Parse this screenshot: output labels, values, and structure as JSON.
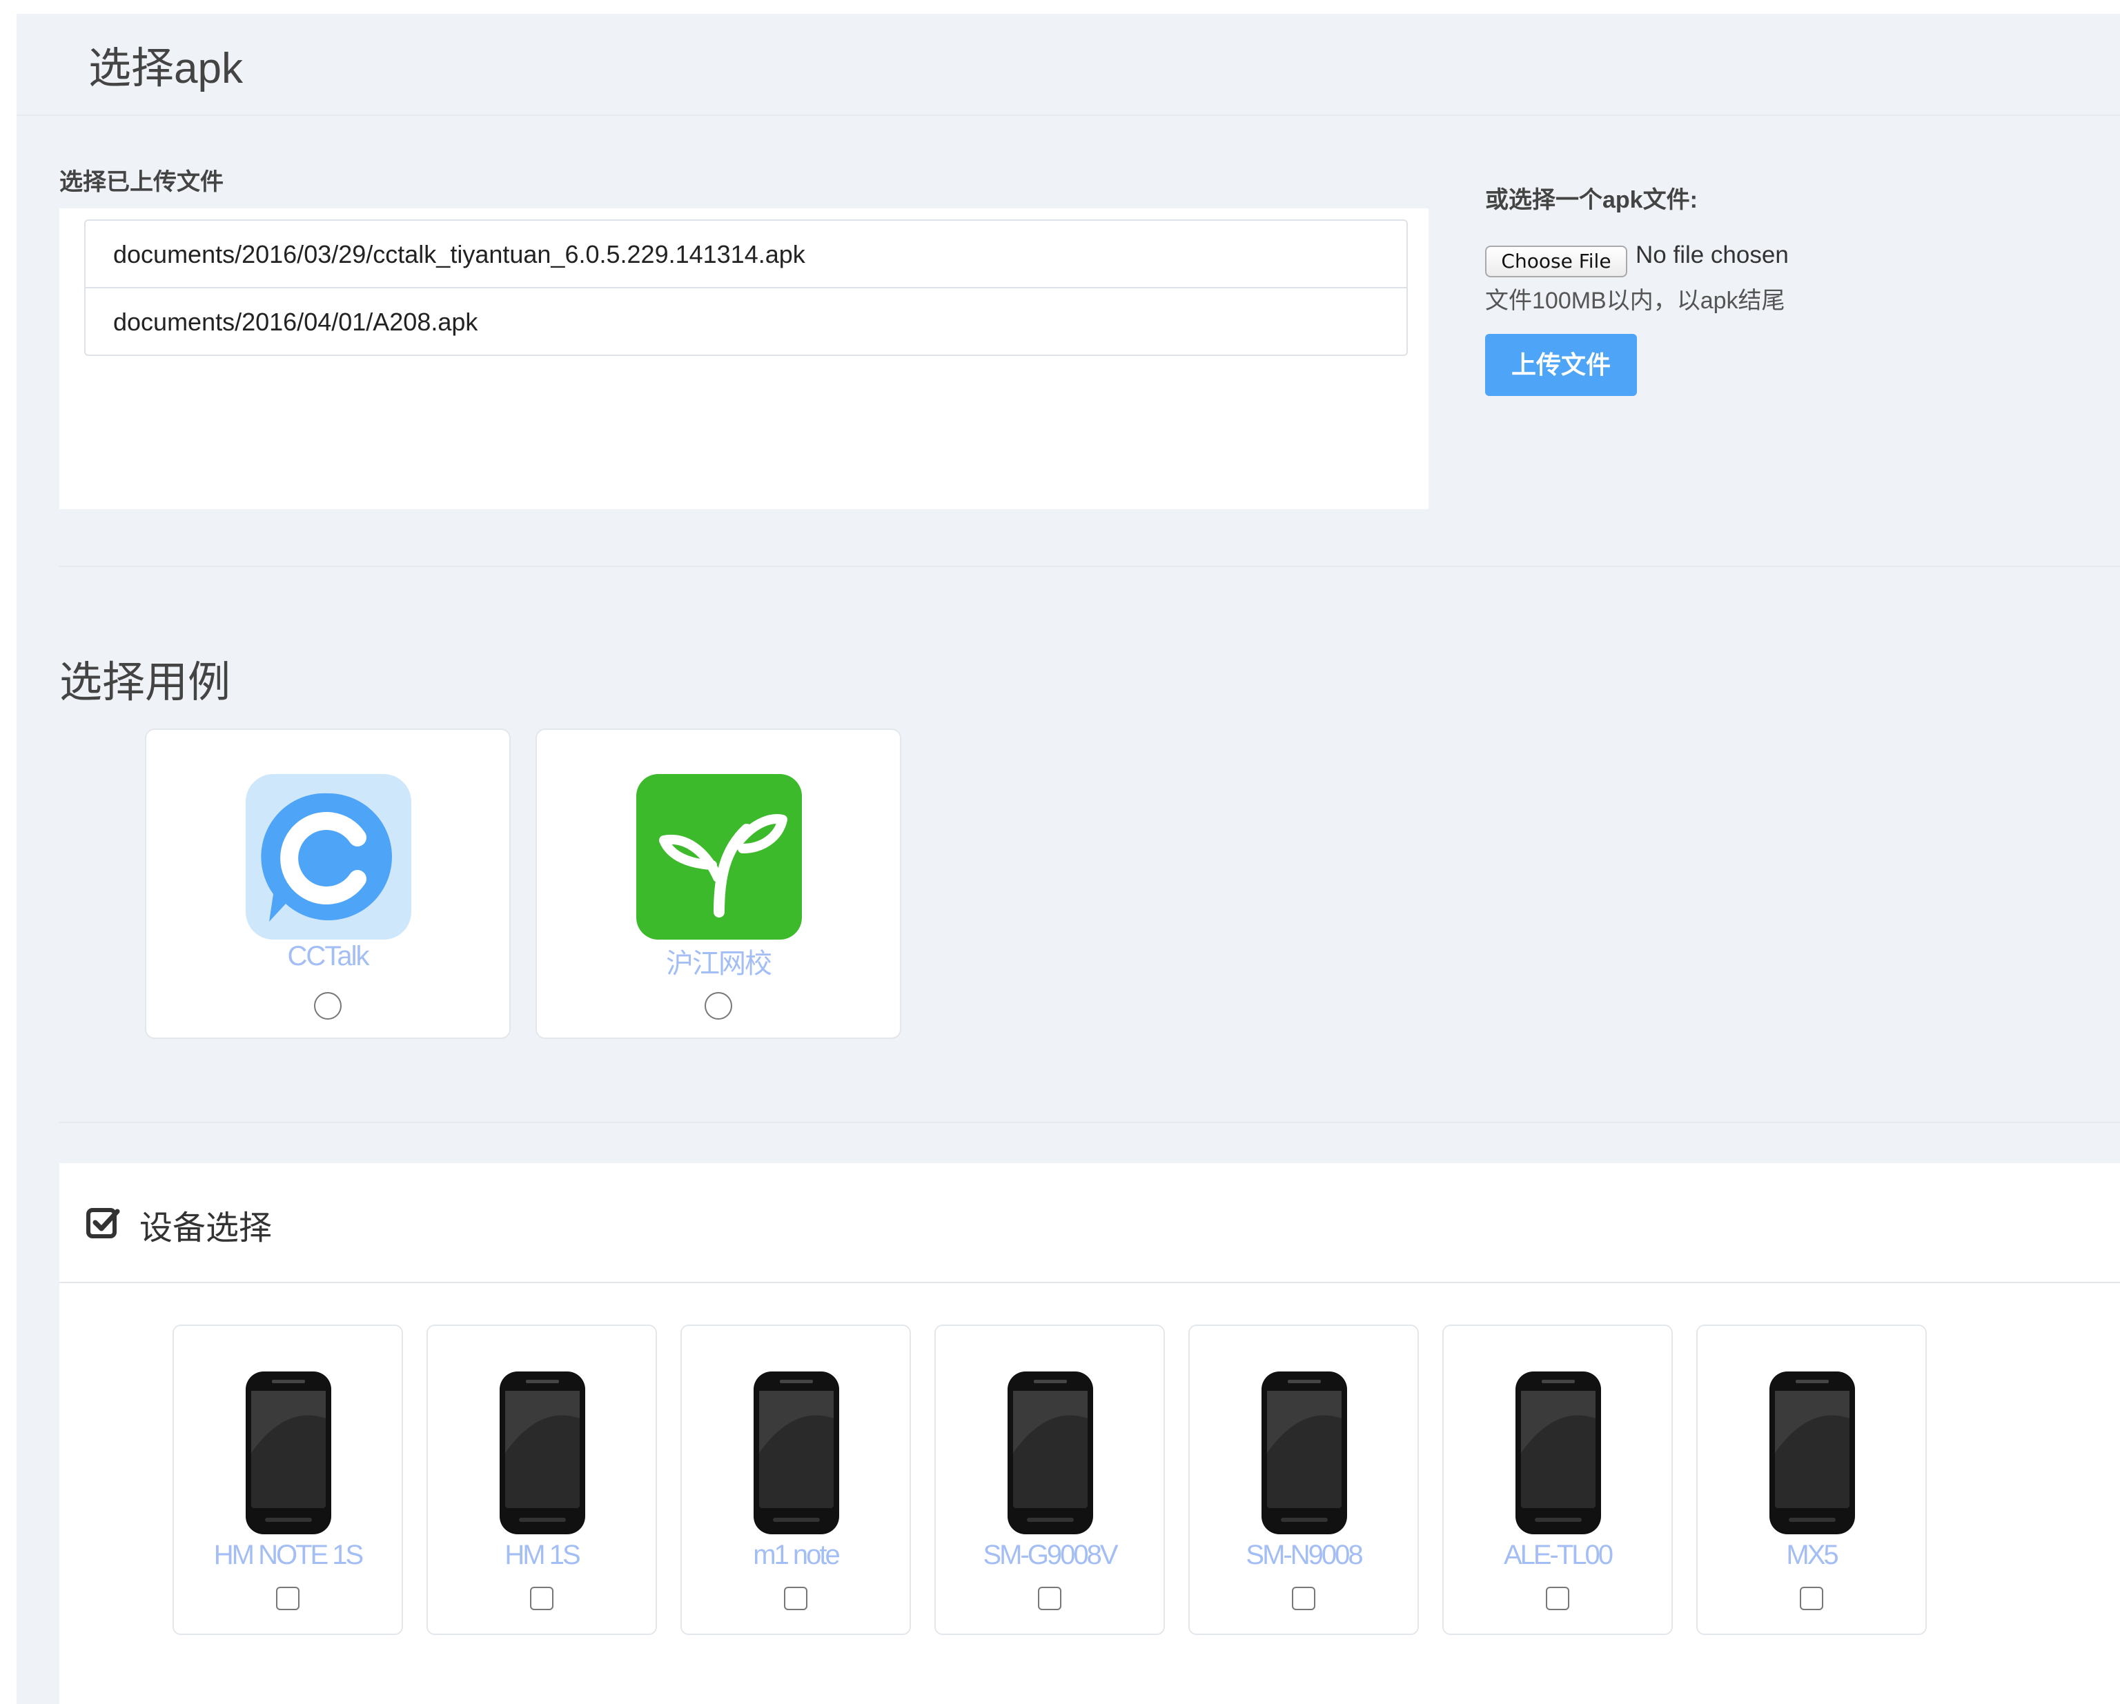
{
  "apk_section": {
    "title": "选择apk",
    "uploaded_label": "选择已上传文件",
    "uploaded_files": [
      "documents/2016/03/29/cctalk_tiyantuan_6.0.5.229.141314.apk",
      "documents/2016/04/01/A208.apk"
    ],
    "or_choose_label": "或选择一个apk文件:",
    "choose_file_button": "Choose File",
    "no_file_text": "No file chosen",
    "size_hint": "文件100MB以内，以apk结尾",
    "upload_button": "上传文件"
  },
  "case_section": {
    "title": "选择用例",
    "cases": [
      {
        "name": "CCTalk",
        "icon": "cctalk-logo-icon",
        "color": "#4ea4f6",
        "selected": false
      },
      {
        "name": "沪江网校",
        "icon": "sprout-logo-icon",
        "color": "#3cba2b",
        "selected": false
      }
    ]
  },
  "device_section": {
    "title": "设备选择",
    "icon": "checkbox-checked-icon",
    "devices": [
      {
        "name": "HM NOTE 1S",
        "checked": false
      },
      {
        "name": "HM 1S",
        "checked": false
      },
      {
        "name": "m1 note",
        "checked": false
      },
      {
        "name": "SM-G9008V",
        "checked": false
      },
      {
        "name": "SM-N9008",
        "checked": false
      },
      {
        "name": "ALE-TL00",
        "checked": false
      },
      {
        "name": "MX5",
        "checked": false
      }
    ]
  },
  "colors": {
    "accent": "#4ea4f6",
    "label_link": "#a3bdf5",
    "panel_bg": "#eff2f6"
  }
}
